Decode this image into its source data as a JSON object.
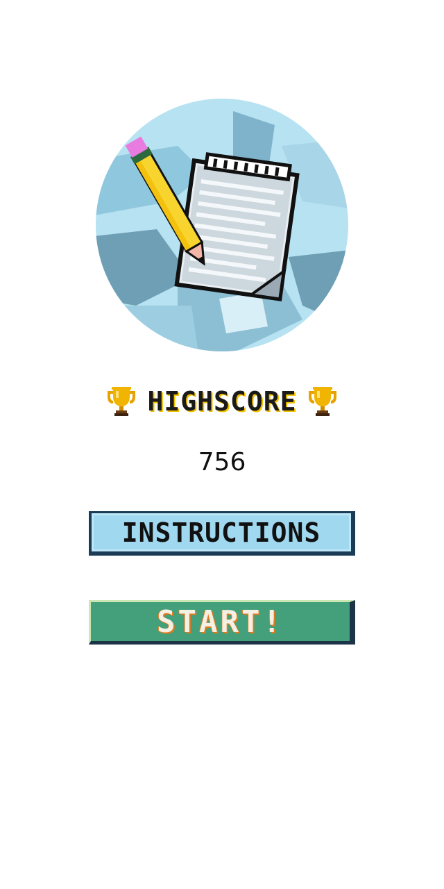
{
  "logo": {
    "icon": "notepad-pencil-icon"
  },
  "highscore": {
    "label": "HIGHSCORE",
    "value": "756",
    "trophy_icon": "trophy-icon",
    "trophy_color": "#f1b400"
  },
  "buttons": {
    "instructions_label": "INSTRUCTIONS",
    "start_label": "START!"
  },
  "colors": {
    "instructions_bg": "#9fd8ef",
    "start_bg": "#43a07a",
    "start_text": "#f4f1e4",
    "start_text_shadow": "#e07a1f",
    "border_dark": "#1b3c55"
  }
}
